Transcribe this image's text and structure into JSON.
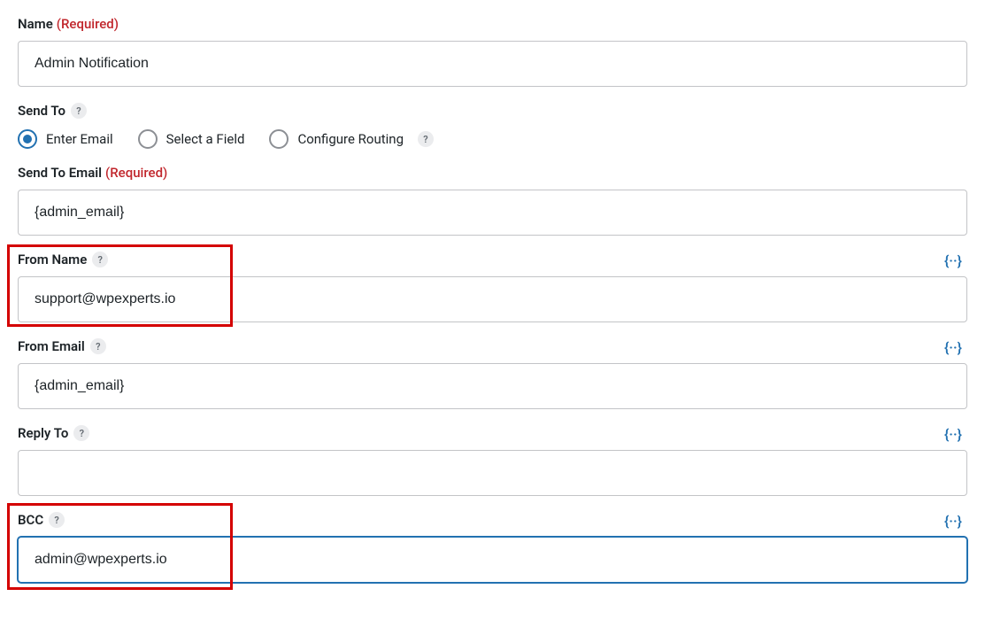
{
  "name": {
    "label": "Name",
    "required_text": "(Required)",
    "value": "Admin Notification"
  },
  "send_to": {
    "label": "Send To",
    "help": "?",
    "options": {
      "enter_email": "Enter Email",
      "select_field": "Select a Field",
      "configure_routing": "Configure Routing"
    },
    "routing_help": "?"
  },
  "send_to_email": {
    "label": "Send To Email",
    "required_text": "(Required)",
    "value": "{admin_email}"
  },
  "from_name": {
    "label": "From Name",
    "help": "?",
    "value": "support@wpexperts.io"
  },
  "from_email": {
    "label": "From Email",
    "help": "?",
    "value": "{admin_email}"
  },
  "reply_to": {
    "label": "Reply To",
    "help": "?",
    "value": ""
  },
  "bcc": {
    "label": "BCC",
    "help": "?",
    "value": "admin@wpexperts.io"
  }
}
